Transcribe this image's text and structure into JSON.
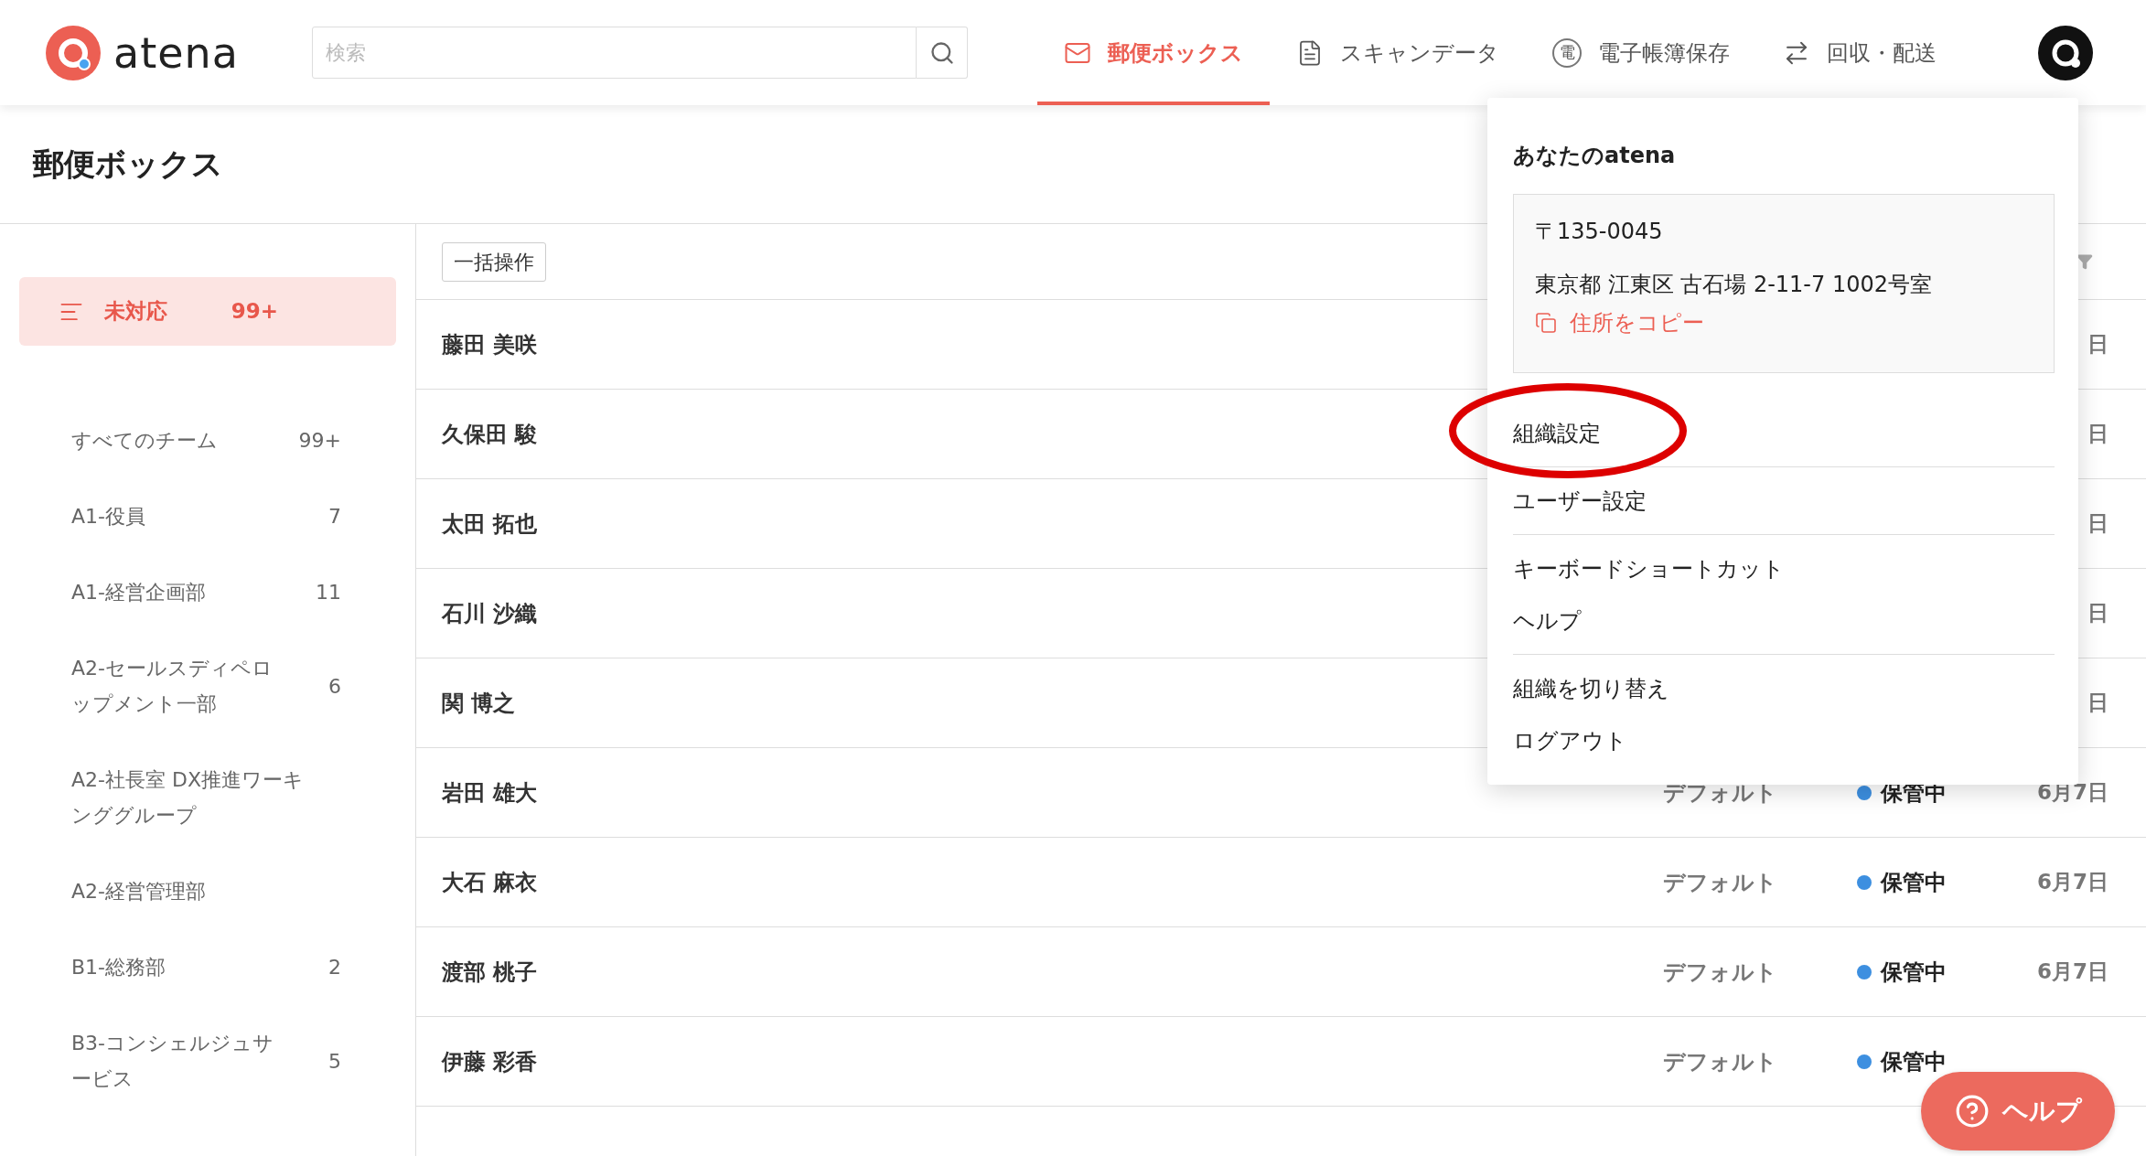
{
  "header": {
    "logo": "atena",
    "search": {
      "placeholder": "検索"
    },
    "nav": [
      {
        "label": "郵便ボックス",
        "selected": true
      },
      {
        "label": "スキャンデータ",
        "selected": false
      },
      {
        "label": "電子帳簿保存",
        "badge": "電",
        "selected": false
      },
      {
        "label": "回収・配送",
        "selected": false
      }
    ]
  },
  "page_title": "郵便ボックス",
  "sidebar": {
    "items": [
      {
        "label_lines": [
          "未対応"
        ],
        "count": "99+",
        "selected": true
      },
      {
        "label_lines": [
          "すべてのチーム"
        ],
        "count": "99+",
        "selected": false
      },
      {
        "label_lines": [
          "A1-役員"
        ],
        "count": "7",
        "selected": false
      },
      {
        "label_lines": [
          "A1-経営企画部"
        ],
        "count": "11",
        "selected": false
      },
      {
        "label_lines": [
          "A2-セールスディペロ",
          "ップメント一部"
        ],
        "count": "6",
        "selected": false
      },
      {
        "label_lines": [
          "A2-社長室 DX推進ワーキ",
          "ンググループ"
        ],
        "selected": false
      },
      {
        "label_lines": [
          "A2-経営管理部"
        ],
        "selected": false
      },
      {
        "label_lines": [
          "B1-総務部"
        ],
        "count": "2",
        "selected": false
      },
      {
        "label_lines": [
          "B3-コンシェルジュサ",
          "ービス"
        ],
        "count": "5",
        "selected": false
      }
    ]
  },
  "toolbar": {
    "bulk_button": "一括操作"
  },
  "rows": [
    {
      "name": "藤田 美咲",
      "date": "日"
    },
    {
      "name": "久保田 駿",
      "date": "日"
    },
    {
      "name": "太田 拓也",
      "date": "日"
    },
    {
      "name": "石川 沙織",
      "date": "日"
    },
    {
      "name": "関 博之",
      "date": "日"
    },
    {
      "name": "岩田 雄大",
      "category": "デフォルト",
      "status": "保管中",
      "date": "6月7日"
    },
    {
      "name": "大石 麻衣",
      "category": "デフォルト",
      "status": "保管中",
      "date": "6月7日"
    },
    {
      "name": "渡部 桃子",
      "category": "デフォルト",
      "status": "保管中",
      "date": "6月7日"
    },
    {
      "name": "伊藤 彩香",
      "category": "デフォルト",
      "status": "保管中"
    }
  ],
  "account_menu": {
    "title": "あなたのatena",
    "postal_code": "〒135-0045",
    "address": "東京都 江東区 古石場 2-11-7 1002号室",
    "copy_link": "住所をコピー",
    "groups": [
      [
        "組織設定"
      ],
      [
        "ユーザー設定"
      ],
      [
        "キーボードショートカット",
        "ヘルプ"
      ],
      [
        "組織を切り替え",
        "ログアウト"
      ]
    ]
  },
  "help_button": "ヘルプ"
}
